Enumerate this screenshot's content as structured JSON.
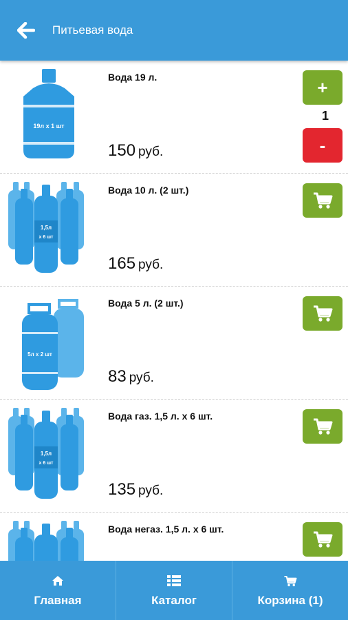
{
  "header": {
    "title": "Питьевая вода",
    "back_icon": "arrow-left-icon"
  },
  "products": [
    {
      "name": "Вода 19 л.",
      "price": "150",
      "currency": "руб.",
      "image": "bottle-19l-image",
      "image_label": "19л х 1 шт",
      "action": "quantity",
      "quantity": "1",
      "plus_label": "+",
      "minus_label": "-"
    },
    {
      "name": "Вода 10 л. (2 шт.)",
      "price": "165",
      "currency": "руб.",
      "image": "six-pack-image",
      "image_label": "1,5л х 6 шт",
      "action": "cart"
    },
    {
      "name": "Вода 5 л. (2 шт.)",
      "price": "83",
      "currency": "руб.",
      "image": "two-bottles-5l-image",
      "image_label": "5л х 2 шт",
      "action": "cart"
    },
    {
      "name": "Вода газ. 1,5 л. х 6 шт.",
      "price": "135",
      "currency": "руб.",
      "image": "six-pack-image",
      "image_label": "1,5л х 6 шт",
      "action": "cart"
    },
    {
      "name": "Вода негаз. 1,5 л. х 6 шт.",
      "price": "",
      "currency": "",
      "image": "six-pack-image",
      "image_label": "",
      "action": "cart"
    }
  ],
  "tabs": [
    {
      "label": "Главная",
      "icon": "home-icon"
    },
    {
      "label": "Каталог",
      "icon": "list-icon"
    },
    {
      "label": "Корзина (1)",
      "icon": "cart-icon"
    }
  ],
  "colors": {
    "primary": "#3a9ad9",
    "add_green": "#7aaa2c",
    "minus_red": "#e3262f",
    "bottle_blue": "#2f9be0"
  }
}
